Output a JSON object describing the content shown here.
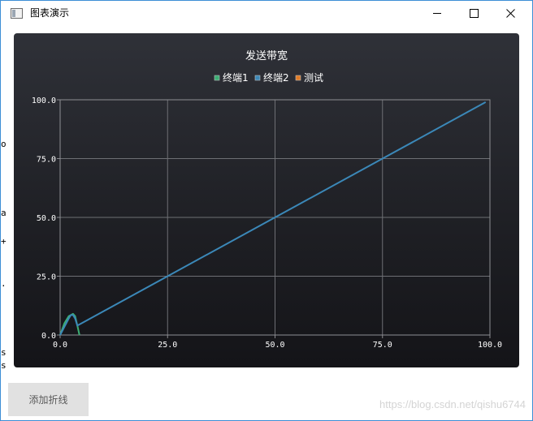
{
  "window": {
    "title": "图表演示",
    "minimize_glyph": "—",
    "maximize_glyph": "☐",
    "close_glyph": "✕"
  },
  "left_clipped_text": [
    "o",
    "a",
    "+",
    ".",
    "s",
    "s"
  ],
  "chart_data": {
    "type": "line",
    "title": "发送带宽",
    "legend_position": "top",
    "grid": true,
    "xlim": [
      0,
      100
    ],
    "ylim": [
      0,
      100
    ],
    "x_ticks": [
      "0.0",
      "25.0",
      "50.0",
      "75.0",
      "100.0"
    ],
    "y_ticks": [
      "0.0",
      "25.0",
      "50.0",
      "75.0",
      "100.0"
    ],
    "series": [
      {
        "name": "终端1",
        "color": "#3cae74",
        "x": [
          0,
          1,
          2,
          2.5,
          3,
          3.5,
          4,
          4.5
        ],
        "y": [
          0,
          5,
          8,
          8.5,
          9,
          8,
          4,
          0
        ]
      },
      {
        "name": "终端2",
        "color": "#3b88b8",
        "x": [
          0,
          2,
          2.5,
          3,
          3.5,
          4,
          10,
          25,
          50,
          75,
          99
        ],
        "y": [
          0,
          7,
          8.5,
          8.5,
          7,
          4,
          10,
          25,
          50,
          75,
          99
        ]
      },
      {
        "name": "测试",
        "color": "#e07b26",
        "x": [],
        "y": []
      }
    ]
  },
  "add_button": {
    "label": "添加折线"
  },
  "watermark": "https://blog.csdn.net/qishu6744"
}
